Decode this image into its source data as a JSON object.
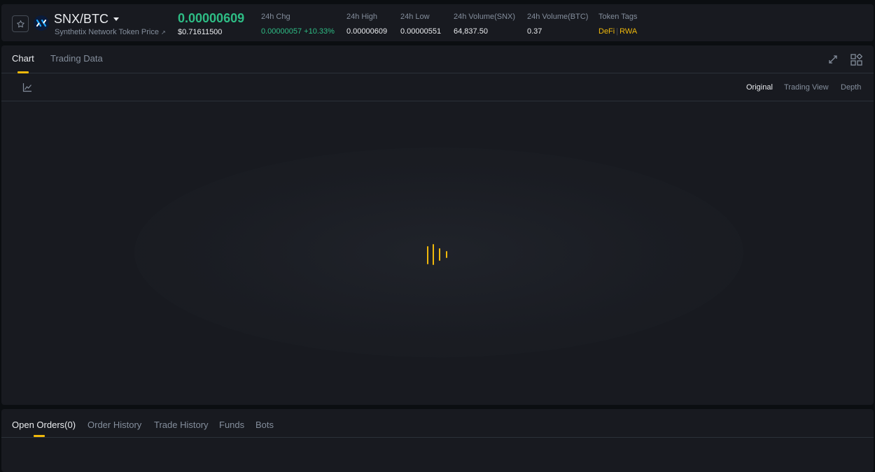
{
  "ticker": {
    "symbol": "SNX/BTC",
    "token_name": "Synthetix Network Token Price",
    "token_name_arrow": "↗",
    "last_price": "0.00000609",
    "usd_price": "$0.71611500",
    "stats": {
      "change": {
        "label": "24h Chg",
        "value": "0.00000057 +10.33%"
      },
      "high": {
        "label": "24h High",
        "value": "0.00000609"
      },
      "low": {
        "label": "24h Low",
        "value": "0.00000551"
      },
      "vol_base": {
        "label": "24h Volume(SNX)",
        "value": "64,837.50"
      },
      "vol_quote": {
        "label": "24h Volume(BTC)",
        "value": "0.37"
      },
      "tags": {
        "label": "Token Tags",
        "items": [
          "DeFi",
          "RWA"
        ],
        "separator": "|"
      }
    },
    "colors": {
      "up": "#2ebd85",
      "accent": "#f0b90b"
    },
    "icons": {
      "favorite": "star-icon",
      "coin": "snx-logo-icon",
      "dropdown": "caret-down-icon"
    }
  },
  "chart_panel": {
    "tabs": [
      "Chart",
      "Trading Data"
    ],
    "active_tab": "Chart",
    "icons": {
      "fullscreen": "expand-icon",
      "layout": "layout-grid-icon",
      "indicator": "line-chart-icon",
      "loading": "loading-bars-icon"
    },
    "view_options": [
      "Original",
      "Trading View",
      "Depth"
    ],
    "active_view": "Original"
  },
  "orders_panel": {
    "tabs": [
      "Open Orders(0)",
      "Order History",
      "Trade History",
      "Funds",
      "Bots"
    ],
    "active_tab": "Open Orders(0)"
  }
}
